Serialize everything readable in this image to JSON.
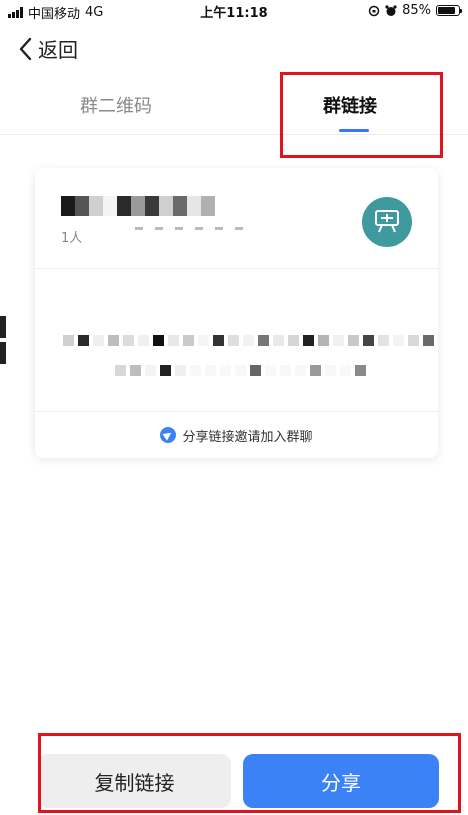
{
  "status_bar": {
    "carrier": "中国移动",
    "network": "4G",
    "time": "上午11:18",
    "battery_percent": "85%",
    "battery_level": 0.85
  },
  "nav": {
    "back_label": "返回"
  },
  "tabs": [
    {
      "label": "群二维码",
      "active": false
    },
    {
      "label": "群链接",
      "active": true
    }
  ],
  "card": {
    "member_count": "1人",
    "share_hint": "分享链接邀请加入群聊",
    "avatar_color": "#3f9aa0"
  },
  "actions": {
    "copy_label": "复制链接",
    "share_label": "分享"
  },
  "colors": {
    "accent": "#3b82f6",
    "annotation": "#e0141c"
  }
}
